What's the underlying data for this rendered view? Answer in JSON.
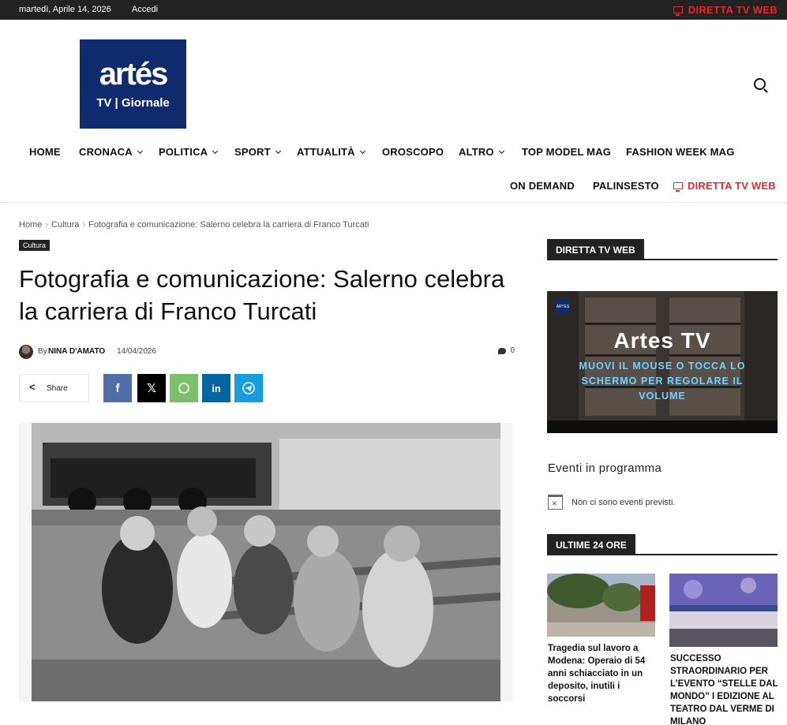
{
  "topbar": {
    "date": "martedì, Aprile 14, 2026",
    "login": "Accedi",
    "live": "DIRETTA TV WEB"
  },
  "logo": {
    "line1": "artés",
    "line2": "TV | Giornale"
  },
  "nav": {
    "row1": [
      {
        "label": "HOME",
        "dropdown": false
      },
      {
        "label": "CRONACA",
        "dropdown": true
      },
      {
        "label": "POLITICA",
        "dropdown": true
      },
      {
        "label": "SPORT",
        "dropdown": true
      },
      {
        "label": "ATTUALITÀ",
        "dropdown": true
      },
      {
        "label": "OROSCOPO",
        "dropdown": false
      },
      {
        "label": "ALTRO",
        "dropdown": true
      },
      {
        "label": "TOP MODEL MAG",
        "dropdown": false
      },
      {
        "label": "FASHION WEEK MAG",
        "dropdown": false
      }
    ],
    "row2": [
      {
        "label": "ON DEMAND"
      },
      {
        "label": "PALINSESTO"
      },
      {
        "label": "DIRETTA TV WEB"
      }
    ]
  },
  "breadcrumb": [
    "Home",
    "Cultura",
    "Fotografia e comunicazione: Salerno celebra la carriera di Franco Turcati"
  ],
  "article": {
    "category": "Cultura",
    "title": "Fotografia e comunicazione: Salerno celebra la carriera di Franco Turcati",
    "by": "By",
    "author": "NINA D'AMATO",
    "date": "14/04/2026",
    "comments": "0",
    "share_label": "Share"
  },
  "sidebar": {
    "live_block_title": "DIRETTA TV WEB",
    "video_title": "Artes TV",
    "video_sub": "MUOVI IL MOUSE O TOCCA LO SCHERMO PER REGOLARE IL VOLUME",
    "events_title": "Eventi in programma",
    "events_none": "Non ci sono eventi previsti.",
    "latest_title": "ULTIME 24 ORE",
    "latest": [
      {
        "title": "Tragedia sul lavoro a Modena: Operaio di 54 anni schiacciato in un deposito, inutili i soccorsi"
      },
      {
        "title": "SUCCESSO STRAORDINARIO PER L’EVENTO “STELLE DAL MONDO” I EDIZIONE AL TEATRO DAL VERME DI MILANO"
      }
    ]
  },
  "colors": {
    "live_red": "#e8262b",
    "logo_blue": "#102a6e",
    "dark": "#222222"
  }
}
